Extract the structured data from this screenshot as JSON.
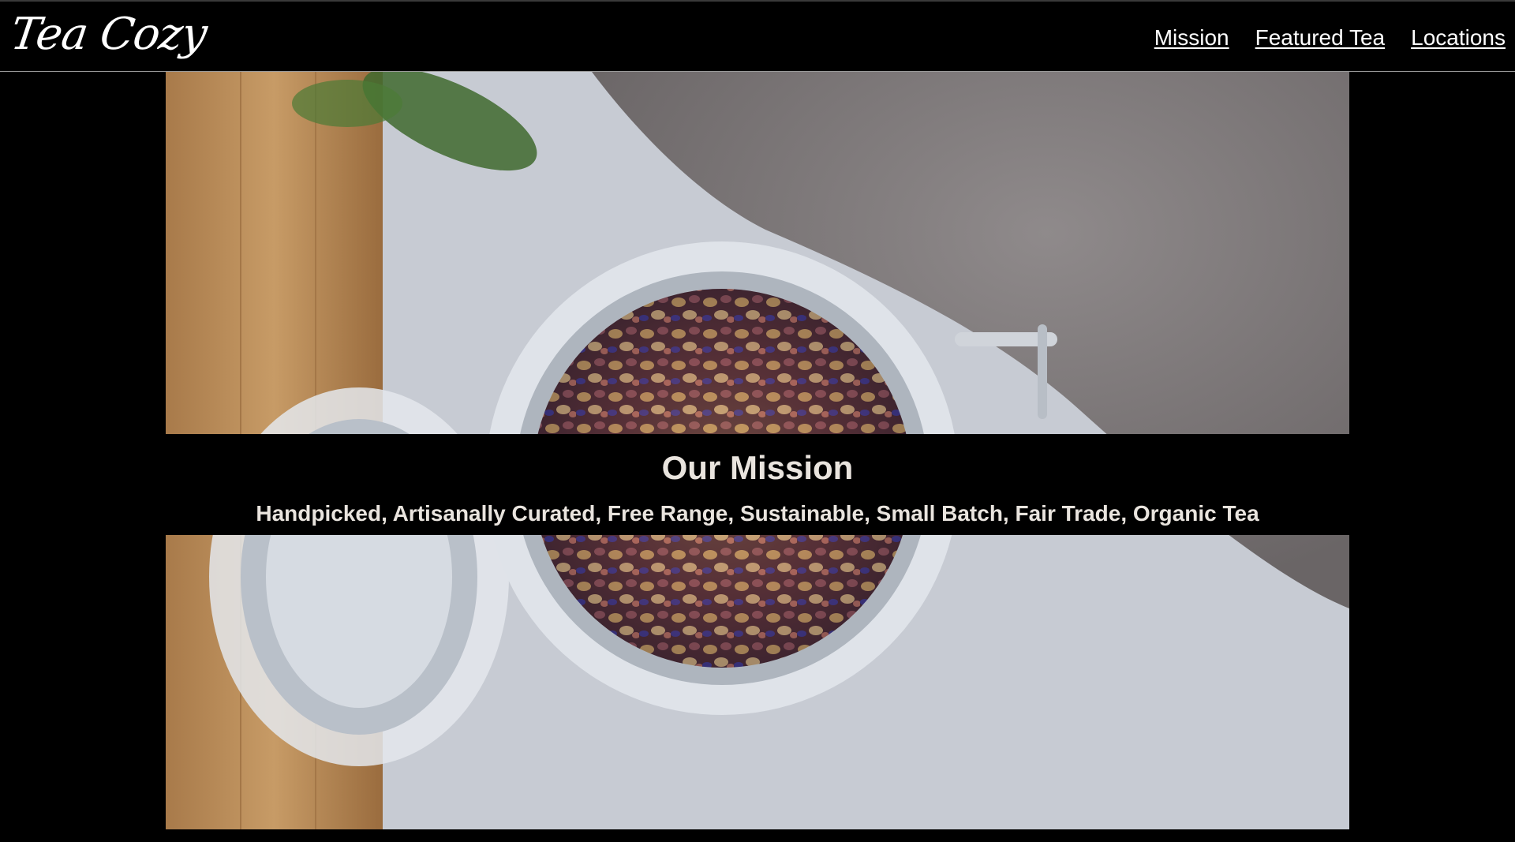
{
  "header": {
    "logo": "Tea Cozy",
    "nav": [
      {
        "label": "Mission"
      },
      {
        "label": "Featured Tea"
      },
      {
        "label": "Locations"
      }
    ]
  },
  "mission": {
    "title": "Our Mission",
    "subtitle": "Handpicked, Artisanally Curated, Free Range, Sustainable, Small Batch, Fair Trade, Organic Tea"
  },
  "colors": {
    "background": "#000000",
    "text": "#ffffff",
    "mission_text": "#e9e4de"
  }
}
